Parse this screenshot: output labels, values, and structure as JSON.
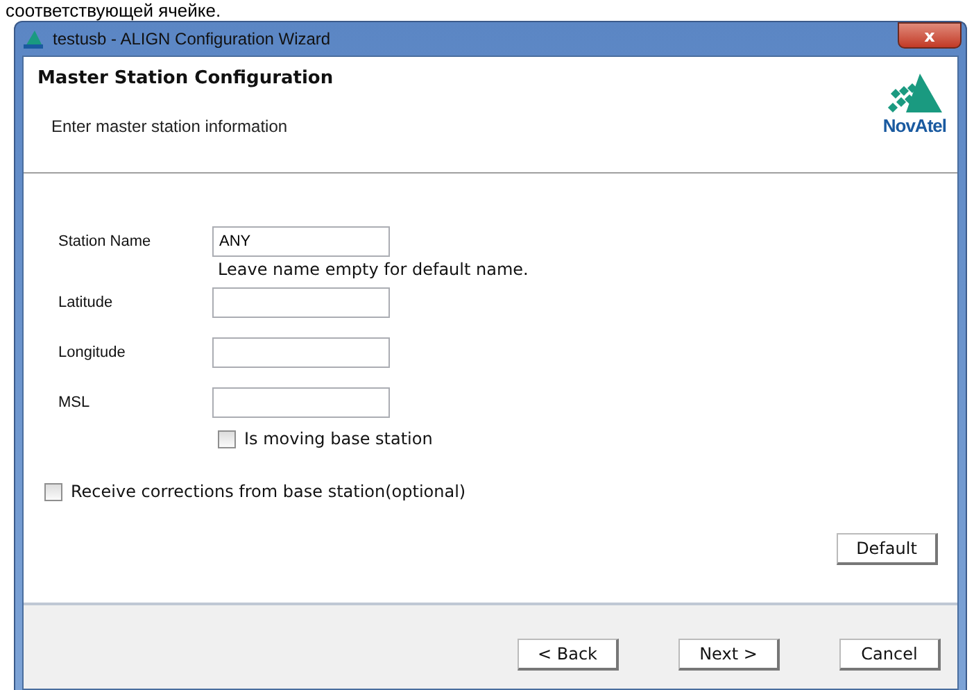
{
  "caption": "соответствующей ячейке.",
  "window": {
    "title": "testusb - ALIGN Configuration Wizard",
    "close": "x"
  },
  "header": {
    "title": "Master Station Configuration",
    "subtitle": "Enter master station information",
    "logo_text": "NovAtel"
  },
  "form": {
    "fields": [
      {
        "label": "Station Name",
        "value": "ANY",
        "hint": "Leave name empty for default name."
      },
      {
        "label": "Latitude"
      },
      {
        "label": "Longitude"
      },
      {
        "label": "MSL"
      }
    ],
    "moving_base": {
      "label": "Is moving base station",
      "checked": false
    },
    "corrections": {
      "label": "Receive corrections from base station(optional)",
      "checked": false
    },
    "default_button": "Default"
  },
  "footer": {
    "buttons": [
      "< Back",
      "Next >",
      "Cancel"
    ]
  }
}
